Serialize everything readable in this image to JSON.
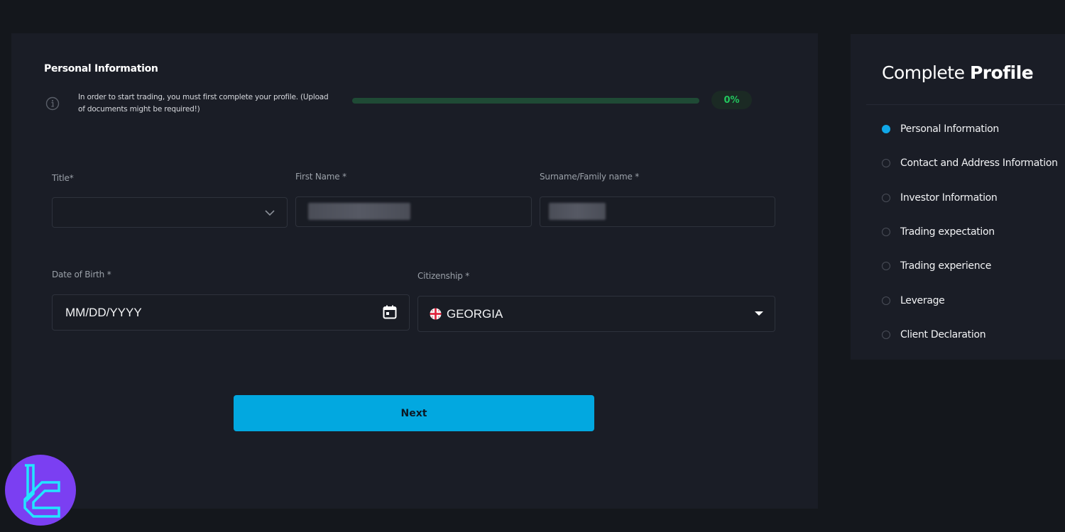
{
  "form": {
    "section_title": "Personal Information",
    "info_icon": "info-circle-icon",
    "info_text": "In order to start trading, you must first complete your profile. (Upload of documents might be required!)",
    "progress": {
      "percent": 0,
      "label": "0%"
    },
    "fields": {
      "title": {
        "label": "Title*",
        "value": "",
        "icon": "chevron-down-icon"
      },
      "first_name": {
        "label": "First Name *",
        "value": "[redacted]"
      },
      "surname": {
        "label": "Surname/Family name *",
        "value": "[redacted]"
      },
      "date_of_birth": {
        "label": "Date of Birth *",
        "placeholder": "MM/DD/YYYY",
        "icon": "calendar-icon"
      },
      "citizenship": {
        "label": "Citizenship *",
        "value": "GEORGIA",
        "flag": "georgia-flag-icon",
        "icon": "caret-down-icon"
      }
    },
    "next_label": "Next"
  },
  "sidebar": {
    "title_light": "Complete",
    "title_bold": "Profile",
    "steps": [
      {
        "label": "Personal Information",
        "active": true
      },
      {
        "label": "Contact and Address Information",
        "active": false
      },
      {
        "label": "Investor Information",
        "active": false
      },
      {
        "label": "Trading expectation",
        "active": false
      },
      {
        "label": "Trading experience",
        "active": false
      },
      {
        "label": "Leverage",
        "active": false
      },
      {
        "label": "Client Declaration",
        "active": false
      }
    ]
  },
  "colors": {
    "accent": "#02a8e0",
    "progress_green": "#22c55e",
    "active_step": "#10a8e8",
    "logo_bg": "#7b3ff2",
    "logo_fg": "#22e6ff"
  }
}
